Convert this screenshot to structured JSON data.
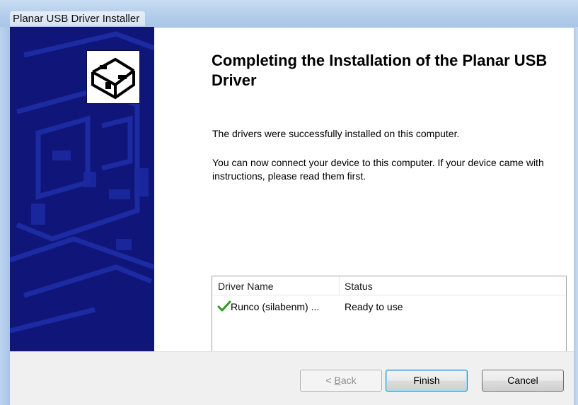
{
  "window": {
    "title": "Planar USB Driver Installer"
  },
  "banner": {
    "background_color": "#10157a",
    "icon": "hardware-install-icon"
  },
  "content": {
    "heading": "Completing the Installation of the Planar USB Driver",
    "message1": "The drivers were successfully installed on this computer.",
    "message2": "You can now connect your device to this computer. If your device came with instructions, please read them first."
  },
  "driver_list": {
    "columns": [
      "Driver Name",
      "Status"
    ],
    "rows": [
      {
        "icon": "green-check-icon",
        "name": "Runco (silabenm) ...",
        "status": "Ready to use"
      }
    ]
  },
  "buttons": {
    "back": {
      "label_prefix": "< ",
      "label_access": "B",
      "label_rest": "ack",
      "enabled": false
    },
    "finish": {
      "label": "Finish",
      "default": true
    },
    "cancel": {
      "label": "Cancel"
    }
  },
  "colors": {
    "titlebar": "#b8d0ec",
    "footer": "#f0f0f0",
    "check": "#2a9d1f"
  }
}
